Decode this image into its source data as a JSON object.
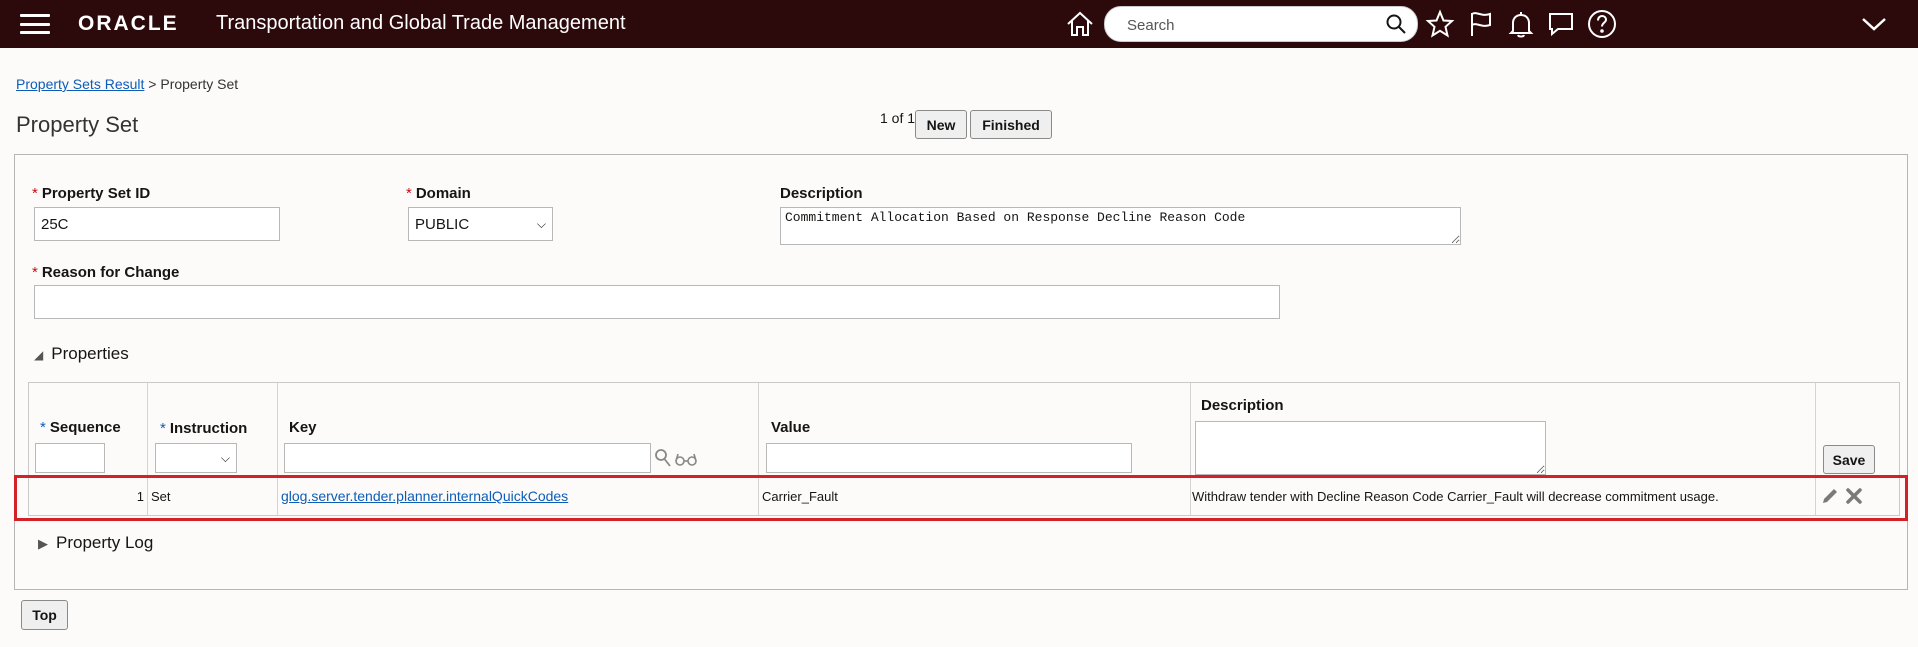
{
  "header": {
    "brand": "ORACLE",
    "app_title": "Transportation and Global Trade Management",
    "search_placeholder": "Search"
  },
  "breadcrumb": {
    "link": "Property Sets Result",
    "separator": ">",
    "current": "Property Set"
  },
  "page": {
    "title": "Property Set",
    "pager": "1 of 1",
    "new_label": "New",
    "finished_label": "Finished"
  },
  "form": {
    "property_set_id": {
      "label": "Property Set ID",
      "value": "25C"
    },
    "domain": {
      "label": "Domain",
      "value": "PUBLIC"
    },
    "description": {
      "label": "Description",
      "value": "Commitment Allocation Based on Response Decline Reason Code"
    },
    "reason_for_change": {
      "label": "Reason for Change",
      "value": ""
    },
    "required_marker": "*"
  },
  "properties": {
    "section_label": "Properties",
    "columns": {
      "sequence": "Sequence",
      "instruction": "Instruction",
      "key": "Key",
      "value": "Value",
      "description": "Description"
    },
    "save_label": "Save",
    "rows": [
      {
        "sequence": "1",
        "instruction": "Set",
        "key": "glog.server.tender.planner.internalQuickCodes",
        "value": "Carrier_Fault",
        "description": "Withdraw tender with Decline Reason Code Carrier_Fault will decrease commitment usage."
      }
    ]
  },
  "property_log": {
    "section_label": "Property Log"
  },
  "footer": {
    "top_label": "Top"
  },
  "colors": {
    "topbar": "#2c0a0c",
    "link": "#0d5db8",
    "required": "#c50d0d",
    "highlight": "#d42027"
  }
}
